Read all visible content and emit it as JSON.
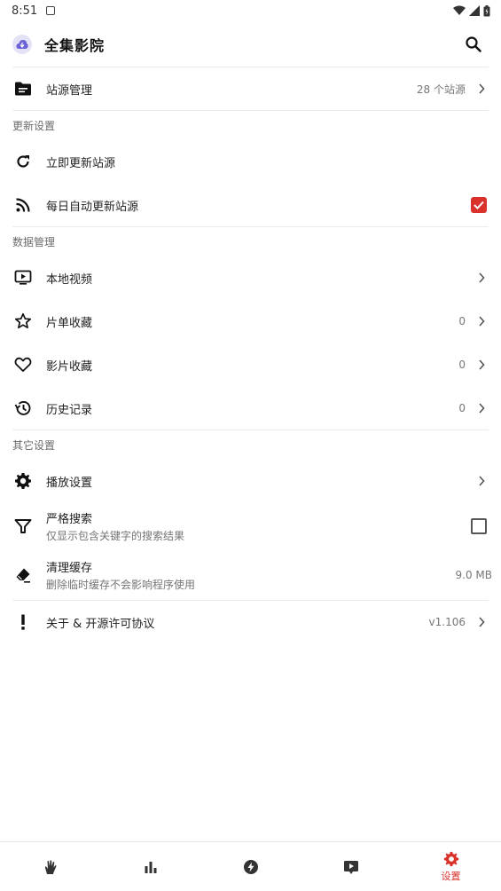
{
  "status": {
    "time": "8:51"
  },
  "app": {
    "title": "全集影院"
  },
  "site_source": {
    "label": "站源管理",
    "value": "28 个站源"
  },
  "update_section": {
    "title": "更新设置",
    "items": [
      {
        "label": "立即更新站源"
      },
      {
        "label": "每日自动更新站源",
        "checked": true
      }
    ]
  },
  "data_section": {
    "title": "数据管理",
    "items": [
      {
        "label": "本地视频",
        "value": ""
      },
      {
        "label": "片单收藏",
        "value": "0"
      },
      {
        "label": "影片收藏",
        "value": "0"
      },
      {
        "label": "历史记录",
        "value": "0"
      }
    ]
  },
  "other_section": {
    "title": "其它设置",
    "play": {
      "label": "播放设置"
    },
    "strict_search": {
      "label": "严格搜索",
      "sub": "仅显示包含关键字的搜索结果",
      "checked": false
    },
    "clear_cache": {
      "label": "清理缓存",
      "sub": "删除临时缓存不会影响程序使用",
      "value": "9.0 MB"
    }
  },
  "about": {
    "label": "关于 & 开源许可协议",
    "value": "v1.106"
  },
  "bottom_nav": {
    "settings_label": "设置"
  },
  "colors": {
    "accent": "#d9312b",
    "text": "#1f1f1f",
    "secondary": "#777777"
  }
}
